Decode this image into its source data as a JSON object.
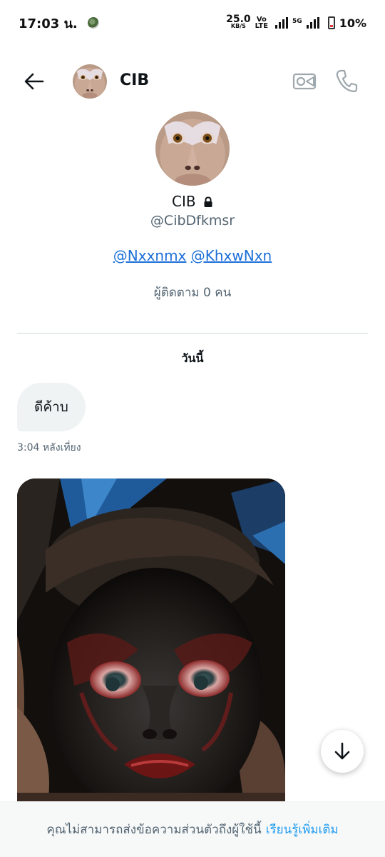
{
  "status_bar": {
    "time": "17:03 น.",
    "net_speed": "25.0",
    "net_speed_unit": "KB/S",
    "volte_top": "Vo",
    "volte_bottom": "LTE",
    "network_type": "5G",
    "battery": "10%"
  },
  "header": {
    "title": "CIB",
    "back_icon": "arrow-left-icon",
    "video_icon": "video-camera-icon",
    "call_icon": "phone-icon"
  },
  "profile": {
    "name": "CIB",
    "handle": "@CibDfkmsr",
    "mentions": [
      "@Nxxnmx",
      "@KhxwNxn"
    ],
    "followers": "ผู้ติดตาม 0 คน"
  },
  "conversation": {
    "date_label": "วันนี้",
    "messages": [
      {
        "text": "ดีค้าบ",
        "time": "3:04 หลังเที่ยง"
      }
    ]
  },
  "footer": {
    "notice": "คุณไม่สามารถส่งข้อความส่วนตัวถึงผู้ใช้นี้",
    "learn_more": "เรียนรู้เพิ่มเติม"
  },
  "colors": {
    "link": "#1d6fd8",
    "accent": "#1d9bf0",
    "secondary_text": "#536471",
    "bubble": "#eff3f4"
  }
}
